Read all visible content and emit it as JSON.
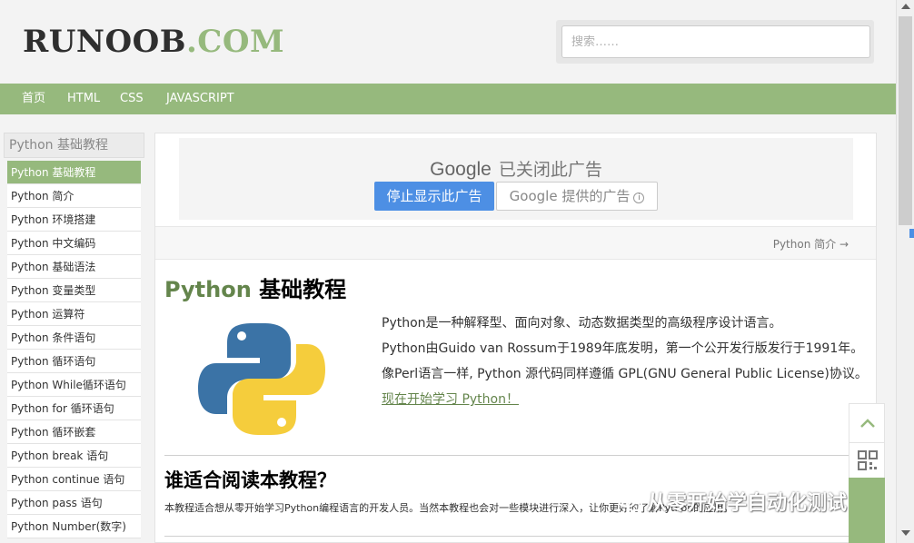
{
  "header": {
    "logo_dark": "RUNOOB",
    "logo_green": ".COM",
    "search_placeholder": "搜索……"
  },
  "nav": {
    "items": [
      {
        "label": "首页"
      },
      {
        "label": "HTML"
      },
      {
        "label": "CSS"
      },
      {
        "label": "JAVASCRIPT"
      }
    ]
  },
  "sidebar": {
    "title": "Python 基础教程",
    "items": [
      {
        "label": "Python 基础教程",
        "active": true
      },
      {
        "label": "Python 简介"
      },
      {
        "label": "Python 环境搭建"
      },
      {
        "label": "Python 中文编码"
      },
      {
        "label": "Python 基础语法"
      },
      {
        "label": "Python 变量类型"
      },
      {
        "label": "Python 运算符"
      },
      {
        "label": "Python 条件语句"
      },
      {
        "label": "Python 循环语句"
      },
      {
        "label": "Python While循环语句"
      },
      {
        "label": "Python for 循环语句"
      },
      {
        "label": "Python 循环嵌套"
      },
      {
        "label": "Python break 语句"
      },
      {
        "label": "Python continue 语句"
      },
      {
        "label": "Python pass 语句"
      },
      {
        "label": "Python Number(数字)"
      }
    ]
  },
  "ad": {
    "brand": "Google",
    "closed_text": "已关闭此广告",
    "stop_label": "停止显示此广告",
    "provided_label": "Google 提供的广告",
    "info_glyph": "i"
  },
  "main": {
    "next_link": "Python 简介 →",
    "title_green": "Python",
    "title_rest": " 基础教程",
    "intro": [
      "Python是一种解释型、面向对象、动态数据类型的高级程序设计语言。",
      "Python由Guido van Rossum于1989年底发明，第一个公开发行版发行于1991年。",
      "像Perl语言一样, Python 源代码同样遵循 GPL(GNU General Public License)协议。"
    ],
    "start_link": "现在开始学习 Python！",
    "section_title": "谁适合阅读本教程？",
    "section_text": "本教程适合想从零开始学习Python编程语言的开发人员。当然本教程也会对一些模块进行深入，让你更好的了解Python的应用。"
  },
  "watermark": {
    "text": "从零开始学自动化测试"
  },
  "colors": {
    "brand_green": "#96b97d",
    "title_green": "#64854c",
    "ad_blue": "#4d8fe4",
    "python_blue": "#3b73a6",
    "python_yellow": "#f5cd3c"
  },
  "icons": {
    "back_to_top": "chevron-up-icon",
    "qr": "qr-code-icon",
    "wechat": "wechat-icon",
    "info": "info-icon"
  }
}
